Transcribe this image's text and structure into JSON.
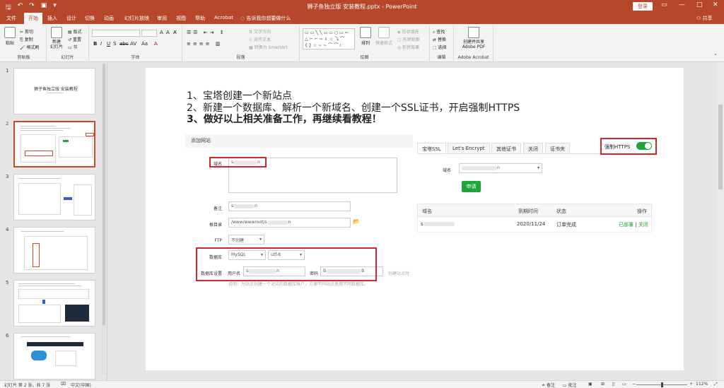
{
  "window": {
    "title": "狮子鱼独立版 安装教程.pptx - PowerPoint",
    "login_label": "登录"
  },
  "ribbon_tabs": [
    "文件",
    "开始",
    "插入",
    "设计",
    "切换",
    "动画",
    "幻灯片放映",
    "审阅",
    "视图",
    "帮助",
    "Acrobat"
  ],
  "tell_me": "告诉我你想要做什么",
  "share_label": "共享",
  "ribbon": {
    "clipboard": {
      "paste": "粘贴",
      "cut": "剪切",
      "copy": "复制",
      "format_painter": "格式刷",
      "group": "剪贴板"
    },
    "slides": {
      "new_slide": "新建\n幻灯片",
      "layout": "版式",
      "reset": "重置",
      "section": "节",
      "group": "幻灯片"
    },
    "font": {
      "group": "字体",
      "format_buttons": [
        "B",
        "I",
        "U",
        "S",
        "abc",
        "AV",
        "Aa",
        "A"
      ]
    },
    "paragraph": {
      "text_direction": "文字方向",
      "align_text": "对齐文本",
      "smartart": "转换为 SmartArt",
      "group": "段落"
    },
    "drawing": {
      "arrange": "排列",
      "quick_styles": "快速样式",
      "shape_fill": "形状填充",
      "shape_outline": "形状轮廓",
      "shape_effects": "形状效果",
      "group": "绘图"
    },
    "editing": {
      "find": "查找",
      "replace": "替换",
      "select": "选择",
      "group": "编辑"
    },
    "adobe": {
      "create_share": "创建并共享\nAdobe PDF",
      "group": "Adobe Acrobat"
    }
  },
  "thumbnails": {
    "numbers": [
      "1",
      "2",
      "3",
      "4",
      "5",
      "6"
    ],
    "slide1_title": "狮子鱼独立版 安装教程"
  },
  "slide": {
    "lines": [
      "1、宝塔创建一个新站点",
      "2、新建一个数据库、解析一个新域名、创建一个SSL证书，开启强制HTTPS",
      "3、做好以上相关准备工作，再继续看教程！"
    ],
    "add_site": {
      "title": "添加网站",
      "domain_label": "域名",
      "domain_prefix": "s",
      "domain_suffix": "n",
      "remark_label": "备注",
      "remark_prefix": "s",
      "remark_suffix": "n",
      "root_label": "根目录",
      "root_value_prefix": "/www/wwwroot/s",
      "root_value_suffix": "n",
      "ftp_label": "FTP",
      "ftp_value": "不创建",
      "db_label": "数据库",
      "db_value": "MySQL",
      "charset_value": "utf-8",
      "db_settings_label": "数据库设置",
      "user_label": "用户名",
      "user_prefix": "s",
      "user_suffix": "n",
      "password_label": "密码",
      "password_prefix": "B",
      "password_suffix": "B",
      "note_right": "创建站点时",
      "note_below": "说明：为站点创建一个对应的数据库帐户，方便不同站点使用不同数据库。"
    },
    "ssl": {
      "tabs": [
        "宝塔SSL",
        "Let's Encrypt",
        "其他证书",
        "关闭",
        "证书夹"
      ],
      "force_https_label": "强制HTTPS",
      "force_https_on": true,
      "domain_label": "域名",
      "domain_suffix": "n",
      "apply_button": "申请",
      "table_headers": [
        "域名",
        "到期时间",
        "状态",
        "操作"
      ],
      "table_row": {
        "domain_prefix": "s",
        "expires": "2020/11/24",
        "status": "订单完成",
        "action_deployed": "已部署",
        "action_sep": " | ",
        "action_close": "关闭"
      }
    }
  },
  "statusbar": {
    "slide_info": "幻灯片 第 2 张，共 7 张",
    "language": "中文(中国)",
    "notes": "备注",
    "comments": "批注",
    "zoom": "112%"
  },
  "colors": {
    "accent": "#b7472a",
    "green": "#20a53a",
    "highlight_red": "#d9252a"
  }
}
